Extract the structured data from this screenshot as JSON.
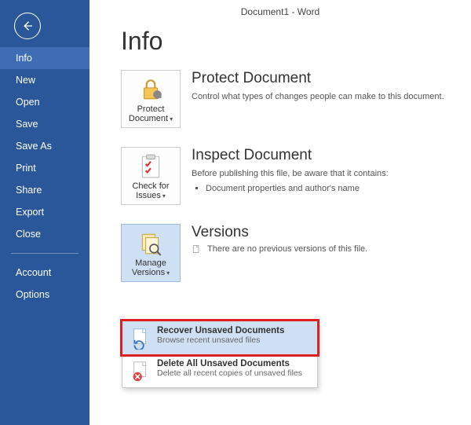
{
  "app_title": "Document1 - Word",
  "sidebar": {
    "items": [
      "Info",
      "New",
      "Open",
      "Save",
      "Save As",
      "Print",
      "Share",
      "Export",
      "Close"
    ],
    "footer": [
      "Account",
      "Options"
    ],
    "active_index": 0
  },
  "page_title": "Info",
  "sections": {
    "protect": {
      "button": "Protect Document",
      "heading": "Protect Document",
      "desc": "Control what types of changes people can make to this document."
    },
    "inspect": {
      "button": "Check for Issues",
      "heading": "Inspect Document",
      "desc": "Before publishing this file, be aware that it contains:",
      "bullet": "Document properties and author's name"
    },
    "versions": {
      "button": "Manage Versions",
      "heading": "Versions",
      "item": "There are no previous versions of this file."
    }
  },
  "menu": {
    "recover": {
      "title": "Recover Unsaved Documents",
      "sub": "Browse recent unsaved files"
    },
    "delete": {
      "title": "Delete All Unsaved Documents",
      "sub": "Delete all recent copies of unsaved files"
    }
  }
}
